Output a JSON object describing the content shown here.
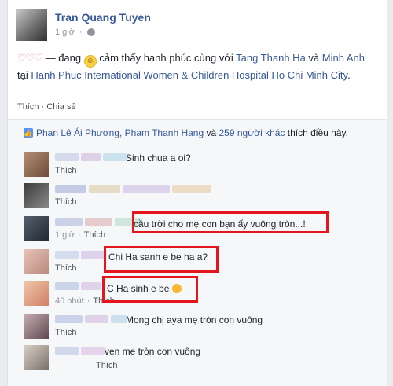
{
  "post": {
    "author": "Tran Quang Tuyen",
    "time": "1 giờ",
    "privacy_icon": "globe-icon",
    "hearts": "♡♡♡",
    "status_dash": " — đang ",
    "status_feeling": " cảm thấy hạnh phúc cùng với ",
    "tag_person": "Tang Thanh Ha",
    "status_and": " và ",
    "tag_person2": "Minh Anh",
    "status_at": " tại ",
    "place": "Hanh Phuc International Women & Children Hospital Ho Chi Minh City",
    "status_end": ".",
    "like_label": "Thích",
    "share_label": "Chia sẻ",
    "separator": " · "
  },
  "likes": {
    "names": "Phan Lê Ái Phương, Pham Thanh Hang",
    "and_text": " và ",
    "others": "259 người khác",
    "suffix": " thích điều này."
  },
  "comments": [
    {
      "text": "Sinh chua a oi?",
      "actions": "Thích"
    },
    {
      "text": "",
      "actions": "Thích"
    },
    {
      "text": "cầu trời cho mẹ con bạn ấy vuông tròn...!",
      "time": "1 giờ",
      "actions": "Thích"
    },
    {
      "text": "Chi Ha sanh e be ha a?",
      "actions": "Thích"
    },
    {
      "text": "C Ha sinh e be",
      "time": "46 phút",
      "actions": "Thích"
    },
    {
      "text": "Mong chị aya mẹ tròn con vuông",
      "actions": "Thích"
    },
    {
      "text": "ven me tròn con vuông",
      "actions": "Thích"
    }
  ],
  "colors": {
    "link": "#365899",
    "highlight": "#e4151d"
  }
}
